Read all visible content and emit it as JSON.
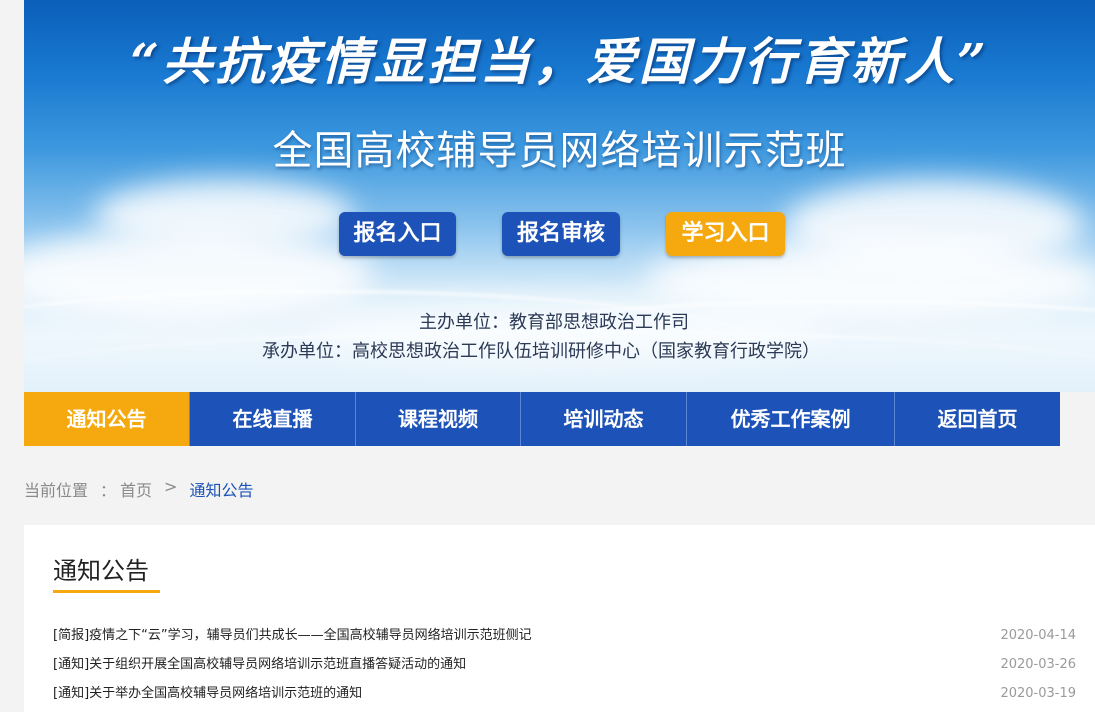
{
  "banner": {
    "slogan": "“共抗疫情显担当，爱国力行育新人”",
    "title": "全国高校辅导员网络培训示范班",
    "buttons": [
      {
        "label": "报名入口",
        "color": "#1d53b8"
      },
      {
        "label": "报名审核",
        "color": "#1d53b8"
      },
      {
        "label": "学习入口",
        "color": "#f5a90e"
      }
    ],
    "host": "主办单位：教育部思想政治工作司",
    "organizer": "承办单位：高校思想政治工作队伍培训研修中心（国家教育行政学院）"
  },
  "nav": {
    "items": [
      {
        "label": "通知公告",
        "active": true
      },
      {
        "label": "在线直播",
        "active": false
      },
      {
        "label": "课程视频",
        "active": false
      },
      {
        "label": "培训动态",
        "active": false
      },
      {
        "label": "优秀工作案例",
        "active": false
      },
      {
        "label": "返回首页",
        "active": false
      }
    ]
  },
  "breadcrumb": {
    "prefix": "当前位置",
    "separator": "：",
    "home": "首页",
    "arrow": ">",
    "current": "通知公告"
  },
  "section": {
    "title": "通知公告",
    "items": [
      {
        "title": "[简报]疫情之下“云”学习，辅导员们共成长——全国高校辅导员网络培训示范班侧记",
        "date": "2020-04-14"
      },
      {
        "title": "[通知]关于组织开展全国高校辅导员网络培训示范班直播答疑活动的通知",
        "date": "2020-03-26"
      },
      {
        "title": "[通知]关于举办全国高校辅导员网络培训示范班的通知",
        "date": "2020-03-19"
      }
    ]
  },
  "colors": {
    "primary": "#1d53b8",
    "accent": "#f5a90e"
  }
}
